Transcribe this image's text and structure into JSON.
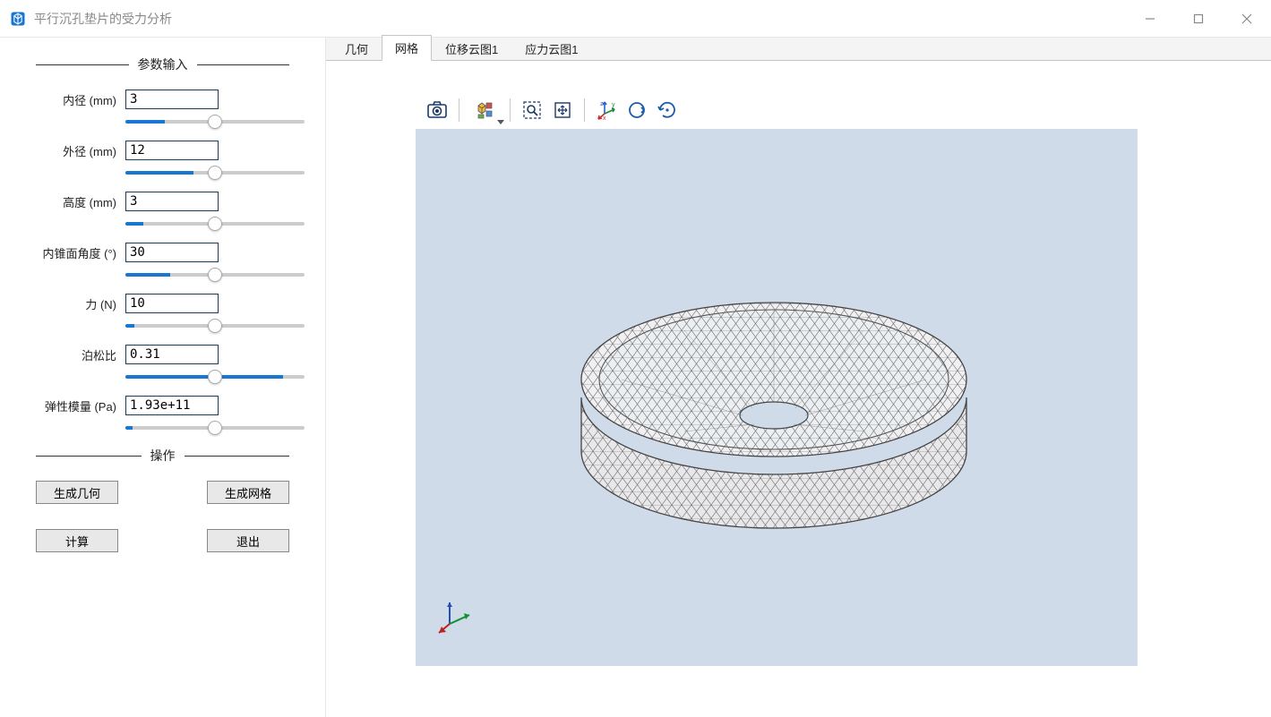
{
  "window": {
    "title": "平行沉孔垫片的受力分析"
  },
  "sidebar": {
    "section_params": "参数输入",
    "section_ops": "操作",
    "params": [
      {
        "label": "内径 (mm)",
        "value": "3",
        "fill": 22
      },
      {
        "label": "外径 (mm)",
        "value": "12",
        "fill": 38
      },
      {
        "label": "高度 (mm)",
        "value": "3",
        "fill": 10
      },
      {
        "label": "内锥面角度 (°)",
        "value": "30",
        "fill": 25
      },
      {
        "label": "力 (N)",
        "value": "10",
        "fill": 5
      },
      {
        "label": "泊松比",
        "value": "0.31",
        "fill": 88
      },
      {
        "label": "弹性模量 (Pa)",
        "value": "1.93e+11",
        "fill": 4
      }
    ],
    "buttons": {
      "gen_geom": "生成几何",
      "gen_mesh": "生成网格",
      "compute": "计算",
      "exit": "退出"
    }
  },
  "tabs": {
    "items": [
      {
        "label": "几何",
        "active": false
      },
      {
        "label": "网格",
        "active": true
      },
      {
        "label": "位移云图1",
        "active": false
      },
      {
        "label": "应力云图1",
        "active": false
      }
    ]
  },
  "toolbar_icons": {
    "camera": "camera-icon",
    "views": "view-presets-icon",
    "zoom_box": "zoom-box-icon",
    "zoom_extents": "zoom-extents-icon",
    "axes": "axes-icon",
    "rotate_cw": "rotate-view-icon",
    "rotate_ccw": "rotate-reset-icon"
  }
}
